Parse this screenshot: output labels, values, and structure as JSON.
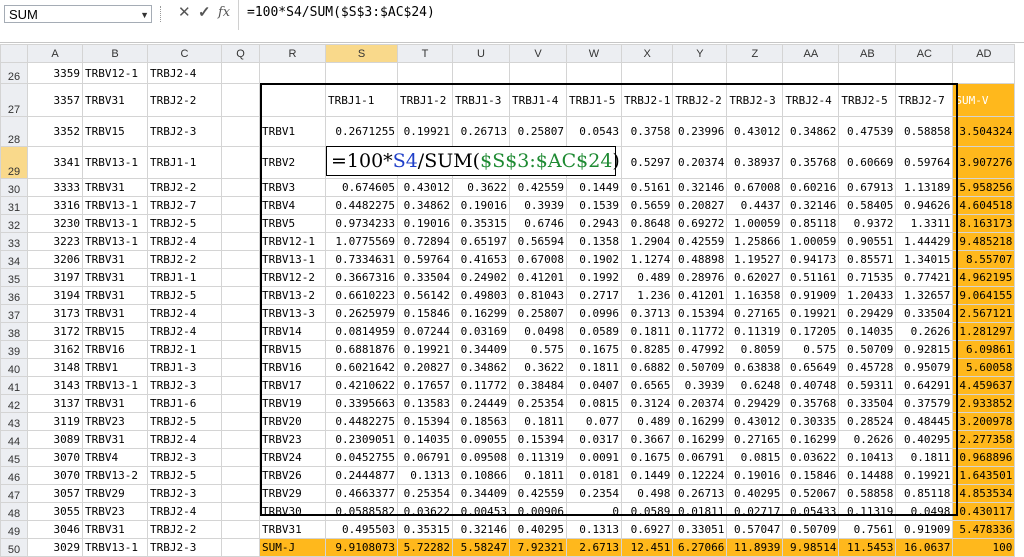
{
  "formula_bar": {
    "name_box": "SUM",
    "cancel_icon": "✕",
    "enter_icon": "✓",
    "fx_label": "fx",
    "formula": "=100*S4/SUM($S$3:$AC$24)"
  },
  "editor": {
    "prefix": "=100*",
    "ref1": "S4",
    "mid": "/SUM(",
    "ref2": "$S$3:$AC$24",
    "suffix": ")"
  },
  "columns": [
    "A",
    "B",
    "C",
    "Q",
    "R",
    "S",
    "T",
    "U",
    "V",
    "W",
    "X",
    "Y",
    "Z",
    "AA",
    "AB",
    "AC",
    "AD"
  ],
  "header_row": {
    "num": "27",
    "a": "3357",
    "b": "TRBV31",
    "c": "TRBJ2-2",
    "labels": [
      "TRBJ1-1",
      "TRBJ1-2",
      "TRBJ1-3",
      "TRBJ1-4",
      "TRBJ1-5",
      "TRBJ2-1",
      "TRBJ2-2",
      "TRBJ2-3",
      "TRBJ2-4",
      "TRBJ2-5",
      "TRBJ2-7"
    ],
    "sumv": "SUM-V"
  },
  "row26": {
    "num": "26",
    "a": "3359",
    "b": "TRBV12-1",
    "c": "TRBJ2-4"
  },
  "rows": [
    {
      "num": "28",
      "a": "3352",
      "b": "TRBV15",
      "c": "TRBJ2-3",
      "r": "TRBV1",
      "v": [
        "0.2671255",
        "0.19921",
        "0.26713",
        "0.25807",
        "0.0543",
        "0.3758",
        "0.23996",
        "0.43012",
        "0.34862",
        "0.47539",
        "0.58858"
      ],
      "sum": "3.504324"
    },
    {
      "num": "29",
      "a": "3341",
      "b": "TRBV13-1",
      "c": "TRBJ1-1",
      "r": "TRBV2",
      "v": [
        "",
        "",
        "",
        "",
        "",
        "0.5297",
        "0.20374",
        "0.38937",
        "0.35768",
        "0.60669",
        "0.59764"
      ],
      "sum": "3.907276"
    },
    {
      "num": "30",
      "a": "3333",
      "b": "TRBV31",
      "c": "TRBJ2-2",
      "r": "TRBV3",
      "v": [
        "0.674605",
        "0.43012",
        "0.3622",
        "0.42559",
        "0.1449",
        "0.5161",
        "0.32146",
        "0.67008",
        "0.60216",
        "0.67913",
        "1.13189"
      ],
      "sum": "5.958256"
    },
    {
      "num": "31",
      "a": "3316",
      "b": "TRBV13-1",
      "c": "TRBJ2-7",
      "r": "TRBV4",
      "v": [
        "0.4482275",
        "0.34862",
        "0.19016",
        "0.3939",
        "0.1539",
        "0.5659",
        "0.20827",
        "0.4437",
        "0.32146",
        "0.58405",
        "0.94626"
      ],
      "sum": "4.604518"
    },
    {
      "num": "32",
      "a": "3230",
      "b": "TRBV13-1",
      "c": "TRBJ2-5",
      "r": "TRBV5",
      "v": [
        "0.9734233",
        "0.19016",
        "0.35315",
        "0.6746",
        "0.2943",
        "0.8648",
        "0.69272",
        "1.00059",
        "0.85118",
        "0.9372",
        "1.3311"
      ],
      "sum": "8.163173"
    },
    {
      "num": "33",
      "a": "3223",
      "b": "TRBV13-1",
      "c": "TRBJ2-4",
      "r": "TRBV12-1",
      "v": [
        "1.0775569",
        "0.72894",
        "0.65197",
        "0.56594",
        "0.1358",
        "1.2904",
        "0.42559",
        "1.25866",
        "1.00059",
        "0.90551",
        "1.44429"
      ],
      "sum": "9.485218"
    },
    {
      "num": "34",
      "a": "3206",
      "b": "TRBV31",
      "c": "TRBJ2-2",
      "r": "TRBV13-1",
      "v": [
        "0.7334631",
        "0.59764",
        "0.41653",
        "0.67008",
        "0.1902",
        "1.1274",
        "0.48898",
        "1.19527",
        "0.94173",
        "0.85571",
        "1.34015"
      ],
      "sum": "8.55707"
    },
    {
      "num": "35",
      "a": "3197",
      "b": "TRBV31",
      "c": "TRBJ1-1",
      "r": "TRBV12-2",
      "v": [
        "0.3667316",
        "0.33504",
        "0.24902",
        "0.41201",
        "0.1992",
        "0.489",
        "0.28976",
        "0.62027",
        "0.51161",
        "0.71535",
        "0.77421"
      ],
      "sum": "4.962195"
    },
    {
      "num": "36",
      "a": "3194",
      "b": "TRBV31",
      "c": "TRBJ2-5",
      "r": "TRBV13-2",
      "v": [
        "0.6610223",
        "0.56142",
        "0.49803",
        "0.81043",
        "0.2717",
        "1.236",
        "0.41201",
        "1.16358",
        "0.91909",
        "1.20433",
        "1.32657"
      ],
      "sum": "9.064155"
    },
    {
      "num": "37",
      "a": "3173",
      "b": "TRBV31",
      "c": "TRBJ2-4",
      "r": "TRBV13-3",
      "v": [
        "0.2625979",
        "0.15846",
        "0.16299",
        "0.25807",
        "0.0996",
        "0.3713",
        "0.15394",
        "0.27165",
        "0.19921",
        "0.29429",
        "0.33504"
      ],
      "sum": "2.567121"
    },
    {
      "num": "38",
      "a": "3172",
      "b": "TRBV15",
      "c": "TRBJ2-4",
      "r": "TRBV14",
      "v": [
        "0.0814959",
        "0.07244",
        "0.03169",
        "0.0498",
        "0.0589",
        "0.1811",
        "0.11772",
        "0.11319",
        "0.17205",
        "0.14035",
        "0.2626"
      ],
      "sum": "1.281297"
    },
    {
      "num": "39",
      "a": "3162",
      "b": "TRBV16",
      "c": "TRBJ2-1",
      "r": "TRBV15",
      "v": [
        "0.6881876",
        "0.19921",
        "0.34409",
        "0.575",
        "0.1675",
        "0.8285",
        "0.47992",
        "0.8059",
        "0.575",
        "0.50709",
        "0.92815"
      ],
      "sum": "6.09861"
    },
    {
      "num": "40",
      "a": "3148",
      "b": "TRBV1",
      "c": "TRBJ1-3",
      "r": "TRBV16",
      "v": [
        "0.6021642",
        "0.20827",
        "0.34862",
        "0.3622",
        "0.1811",
        "0.6882",
        "0.50709",
        "0.63838",
        "0.65649",
        "0.45728",
        "0.95079"
      ],
      "sum": "5.60058"
    },
    {
      "num": "41",
      "a": "3143",
      "b": "TRBV13-1",
      "c": "TRBJ2-3",
      "r": "TRBV17",
      "v": [
        "0.4210622",
        "0.17657",
        "0.11772",
        "0.38484",
        "0.0407",
        "0.6565",
        "0.3939",
        "0.6248",
        "0.40748",
        "0.59311",
        "0.64291"
      ],
      "sum": "4.459637"
    },
    {
      "num": "42",
      "a": "3137",
      "b": "TRBV31",
      "c": "TRBJ1-6",
      "r": "TRBV19",
      "v": [
        "0.3395663",
        "0.13583",
        "0.24449",
        "0.25354",
        "0.0815",
        "0.3124",
        "0.20374",
        "0.29429",
        "0.35768",
        "0.33504",
        "0.37579"
      ],
      "sum": "2.933852"
    },
    {
      "num": "43",
      "a": "3119",
      "b": "TRBV23",
      "c": "TRBJ2-5",
      "r": "TRBV20",
      "v": [
        "0.4482275",
        "0.15394",
        "0.18563",
        "0.1811",
        "0.077",
        "0.489",
        "0.16299",
        "0.43012",
        "0.30335",
        "0.28524",
        "0.48445"
      ],
      "sum": "3.200978"
    },
    {
      "num": "44",
      "a": "3089",
      "b": "TRBV31",
      "c": "TRBJ2-4",
      "r": "TRBV23",
      "v": [
        "0.2309051",
        "0.14035",
        "0.09055",
        "0.15394",
        "0.0317",
        "0.3667",
        "0.16299",
        "0.27165",
        "0.16299",
        "0.2626",
        "0.40295"
      ],
      "sum": "2.277358"
    },
    {
      "num": "45",
      "a": "3070",
      "b": "TRBV4",
      "c": "TRBJ2-3",
      "r": "TRBV24",
      "v": [
        "0.0452755",
        "0.06791",
        "0.09508",
        "0.11319",
        "0.0091",
        "0.1675",
        "0.06791",
        "0.0815",
        "0.03622",
        "0.10413",
        "0.1811"
      ],
      "sum": "0.968896"
    },
    {
      "num": "46",
      "a": "3070",
      "b": "TRBV13-2",
      "c": "TRBJ2-5",
      "r": "TRBV26",
      "v": [
        "0.2444877",
        "0.1313",
        "0.10866",
        "0.1811",
        "0.0181",
        "0.1449",
        "0.12224",
        "0.19016",
        "0.15846",
        "0.14488",
        "0.19921"
      ],
      "sum": "1.643501"
    },
    {
      "num": "47",
      "a": "3057",
      "b": "TRBV29",
      "c": "TRBJ2-3",
      "r": "TRBV29",
      "v": [
        "0.4663377",
        "0.25354",
        "0.34409",
        "0.42559",
        "0.2354",
        "0.498",
        "0.26713",
        "0.40295",
        "0.52067",
        "0.58858",
        "0.85118"
      ],
      "sum": "4.853534"
    },
    {
      "num": "48",
      "a": "3055",
      "b": "TRBV23",
      "c": "TRBJ2-4",
      "r": "TRBV30",
      "v": [
        "0.0588582",
        "0.03622",
        "0.00453",
        "0.00906",
        "0",
        "0.0589",
        "0.01811",
        "0.02717",
        "0.05433",
        "0.11319",
        "0.0498"
      ],
      "sum": "0.430117"
    },
    {
      "num": "49",
      "a": "3046",
      "b": "TRBV31",
      "c": "TRBJ2-2",
      "r": "TRBV31",
      "v": [
        "0.495503",
        "0.35315",
        "0.32146",
        "0.40295",
        "0.1313",
        "0.6927",
        "0.33051",
        "0.57047",
        "0.50709",
        "0.7561",
        "0.91909"
      ],
      "sum": "5.478336"
    }
  ],
  "sum_row": {
    "num": "50",
    "a": "3029",
    "b": "TRBV13-1",
    "c": "TRBJ2-3",
    "r": "SUM-J",
    "v": [
      "9.9108073",
      "5.72282",
      "5.58247",
      "7.92321",
      "2.6713",
      "12.451",
      "6.27066",
      "11.8939",
      "9.98514",
      "11.5453",
      "16.0637"
    ],
    "total": "100"
  }
}
